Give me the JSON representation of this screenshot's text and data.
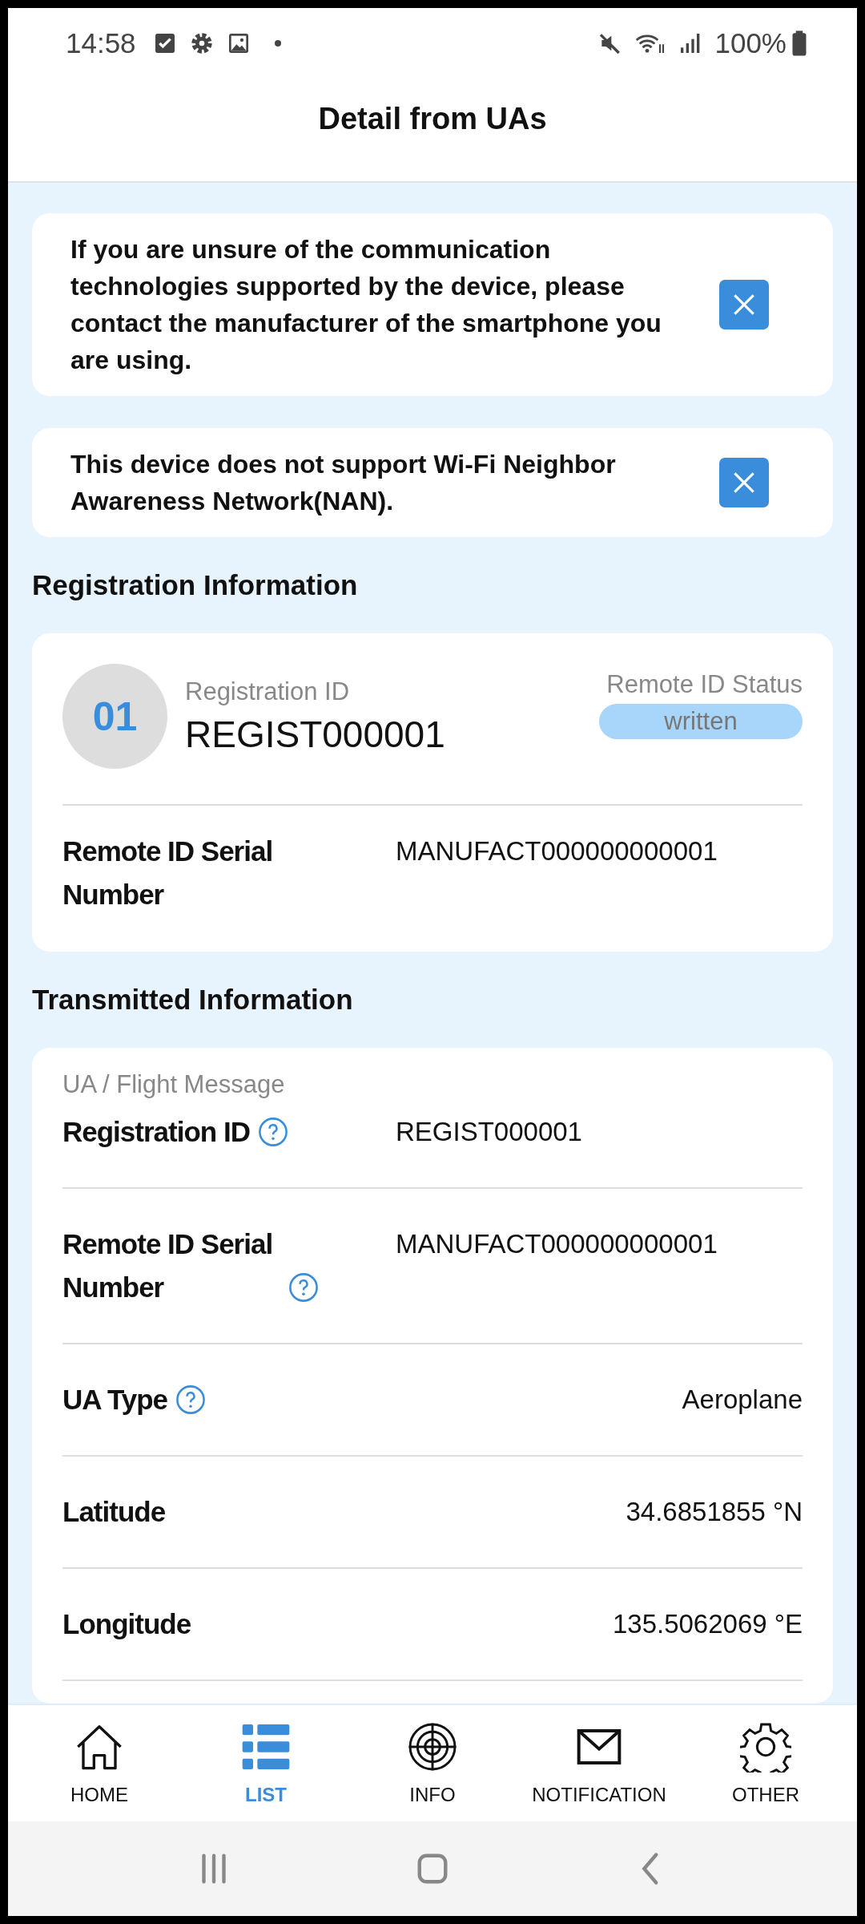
{
  "status_bar": {
    "time": "14:58",
    "battery": "100%"
  },
  "header": {
    "title": "Detail from UAs"
  },
  "notices": [
    {
      "text": "If you are unsure of the communication technologies supported by the device, please contact the manufacturer of the smartphone you are using."
    },
    {
      "text": "This device does not support Wi-Fi Neighbor Awareness Network(NAN)."
    }
  ],
  "registration": {
    "heading": "Registration Information",
    "number": "01",
    "id_label": "Registration ID",
    "id_value": "REGIST000001",
    "status_label": "Remote ID Status",
    "status": "written",
    "rows": [
      {
        "label": "Remote ID Serial Number",
        "value": "MANUFACT000000000001"
      }
    ]
  },
  "transmitted": {
    "heading": "Transmitted Information",
    "group": "UA / Flight Message",
    "rows": [
      {
        "kind": "id",
        "label": "Registration ID",
        "help": true,
        "value": "REGIST000001"
      },
      {
        "kind": "id",
        "label": "Remote ID Serial Number",
        "help": true,
        "value": "MANUFACT000000000001"
      },
      {
        "kind": "reading",
        "label": "UA Type",
        "help": true,
        "value": "Aeroplane"
      },
      {
        "kind": "reading",
        "label": "Latitude",
        "help": false,
        "value": "34.6851855 °N"
      },
      {
        "kind": "reading",
        "label": "Longitude",
        "help": false,
        "value": "135.5062069 °E"
      }
    ]
  },
  "nav": [
    {
      "label": "HOME",
      "selected": false
    },
    {
      "label": "LIST",
      "selected": true
    },
    {
      "label": "INFO",
      "selected": false
    },
    {
      "label": "NOTIFICATION",
      "selected": false
    },
    {
      "label": "OTHER",
      "selected": false
    }
  ]
}
